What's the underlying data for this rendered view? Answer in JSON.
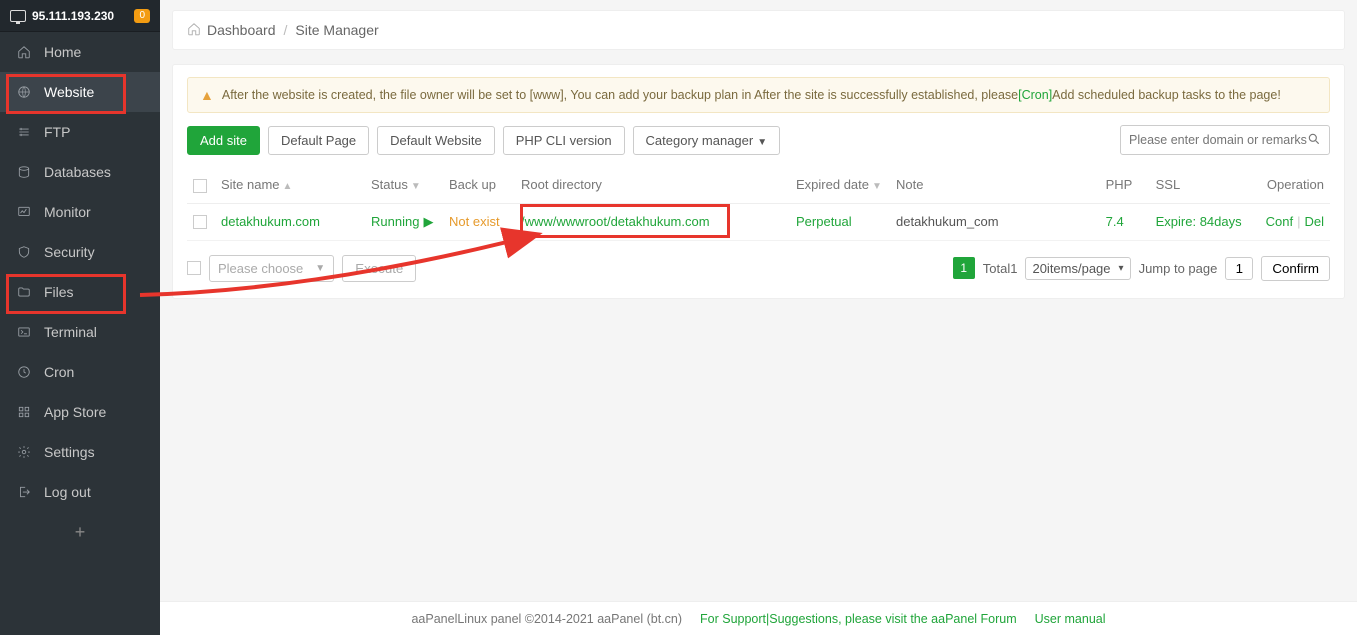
{
  "header": {
    "ip": "95.111.193.230",
    "badge": "0"
  },
  "sidebar": {
    "items": [
      {
        "label": "Home"
      },
      {
        "label": "Website"
      },
      {
        "label": "FTP"
      },
      {
        "label": "Databases"
      },
      {
        "label": "Monitor"
      },
      {
        "label": "Security"
      },
      {
        "label": "Files"
      },
      {
        "label": "Terminal"
      },
      {
        "label": "Cron"
      },
      {
        "label": "App Store"
      },
      {
        "label": "Settings"
      },
      {
        "label": "Log out"
      }
    ]
  },
  "breadcrumb": {
    "root": "Dashboard",
    "page": "Site Manager"
  },
  "warning": {
    "before": "After the website is created, the file owner will be set to [www], You can add your backup plan in After the site is successfully established, please",
    "link": "[Cron]",
    "after": "Add scheduled backup tasks to the page!"
  },
  "toolbar": {
    "add": "Add site",
    "default_page": "Default Page",
    "default_site": "Default Website",
    "php_cli": "PHP CLI version",
    "category": "Category manager",
    "search_placeholder": "Please enter domain or remarks"
  },
  "columns": {
    "site": "Site name",
    "status": "Status",
    "backup": "Back up",
    "root": "Root directory",
    "expired": "Expired date",
    "note": "Note",
    "php": "PHP",
    "ssl": "SSL",
    "op": "Operation"
  },
  "rows": [
    {
      "site": "detakhukum.com",
      "status": "Running",
      "backup": "Not exist",
      "root": "/www/wwwroot/detakhukum.com",
      "expired": "Perpetual",
      "note": "detakhukum_com",
      "php": "7.4",
      "ssl": "Expire: 84days",
      "conf": "Conf",
      "del": "Del"
    }
  ],
  "bulk": {
    "placeholder": "Please choose",
    "execute": "Execute"
  },
  "pagination": {
    "current": "1",
    "total_label": "Total",
    "total": "1",
    "per_page": "20items/page",
    "jump_label": "Jump to page",
    "jump_value": "1",
    "confirm": "Confirm"
  },
  "footer": {
    "copyright": "aaPanelLinux panel ©2014-2021 aaPanel (bt.cn)",
    "support": "For Support|Suggestions, please visit the aaPanel Forum",
    "manual": "User manual"
  }
}
